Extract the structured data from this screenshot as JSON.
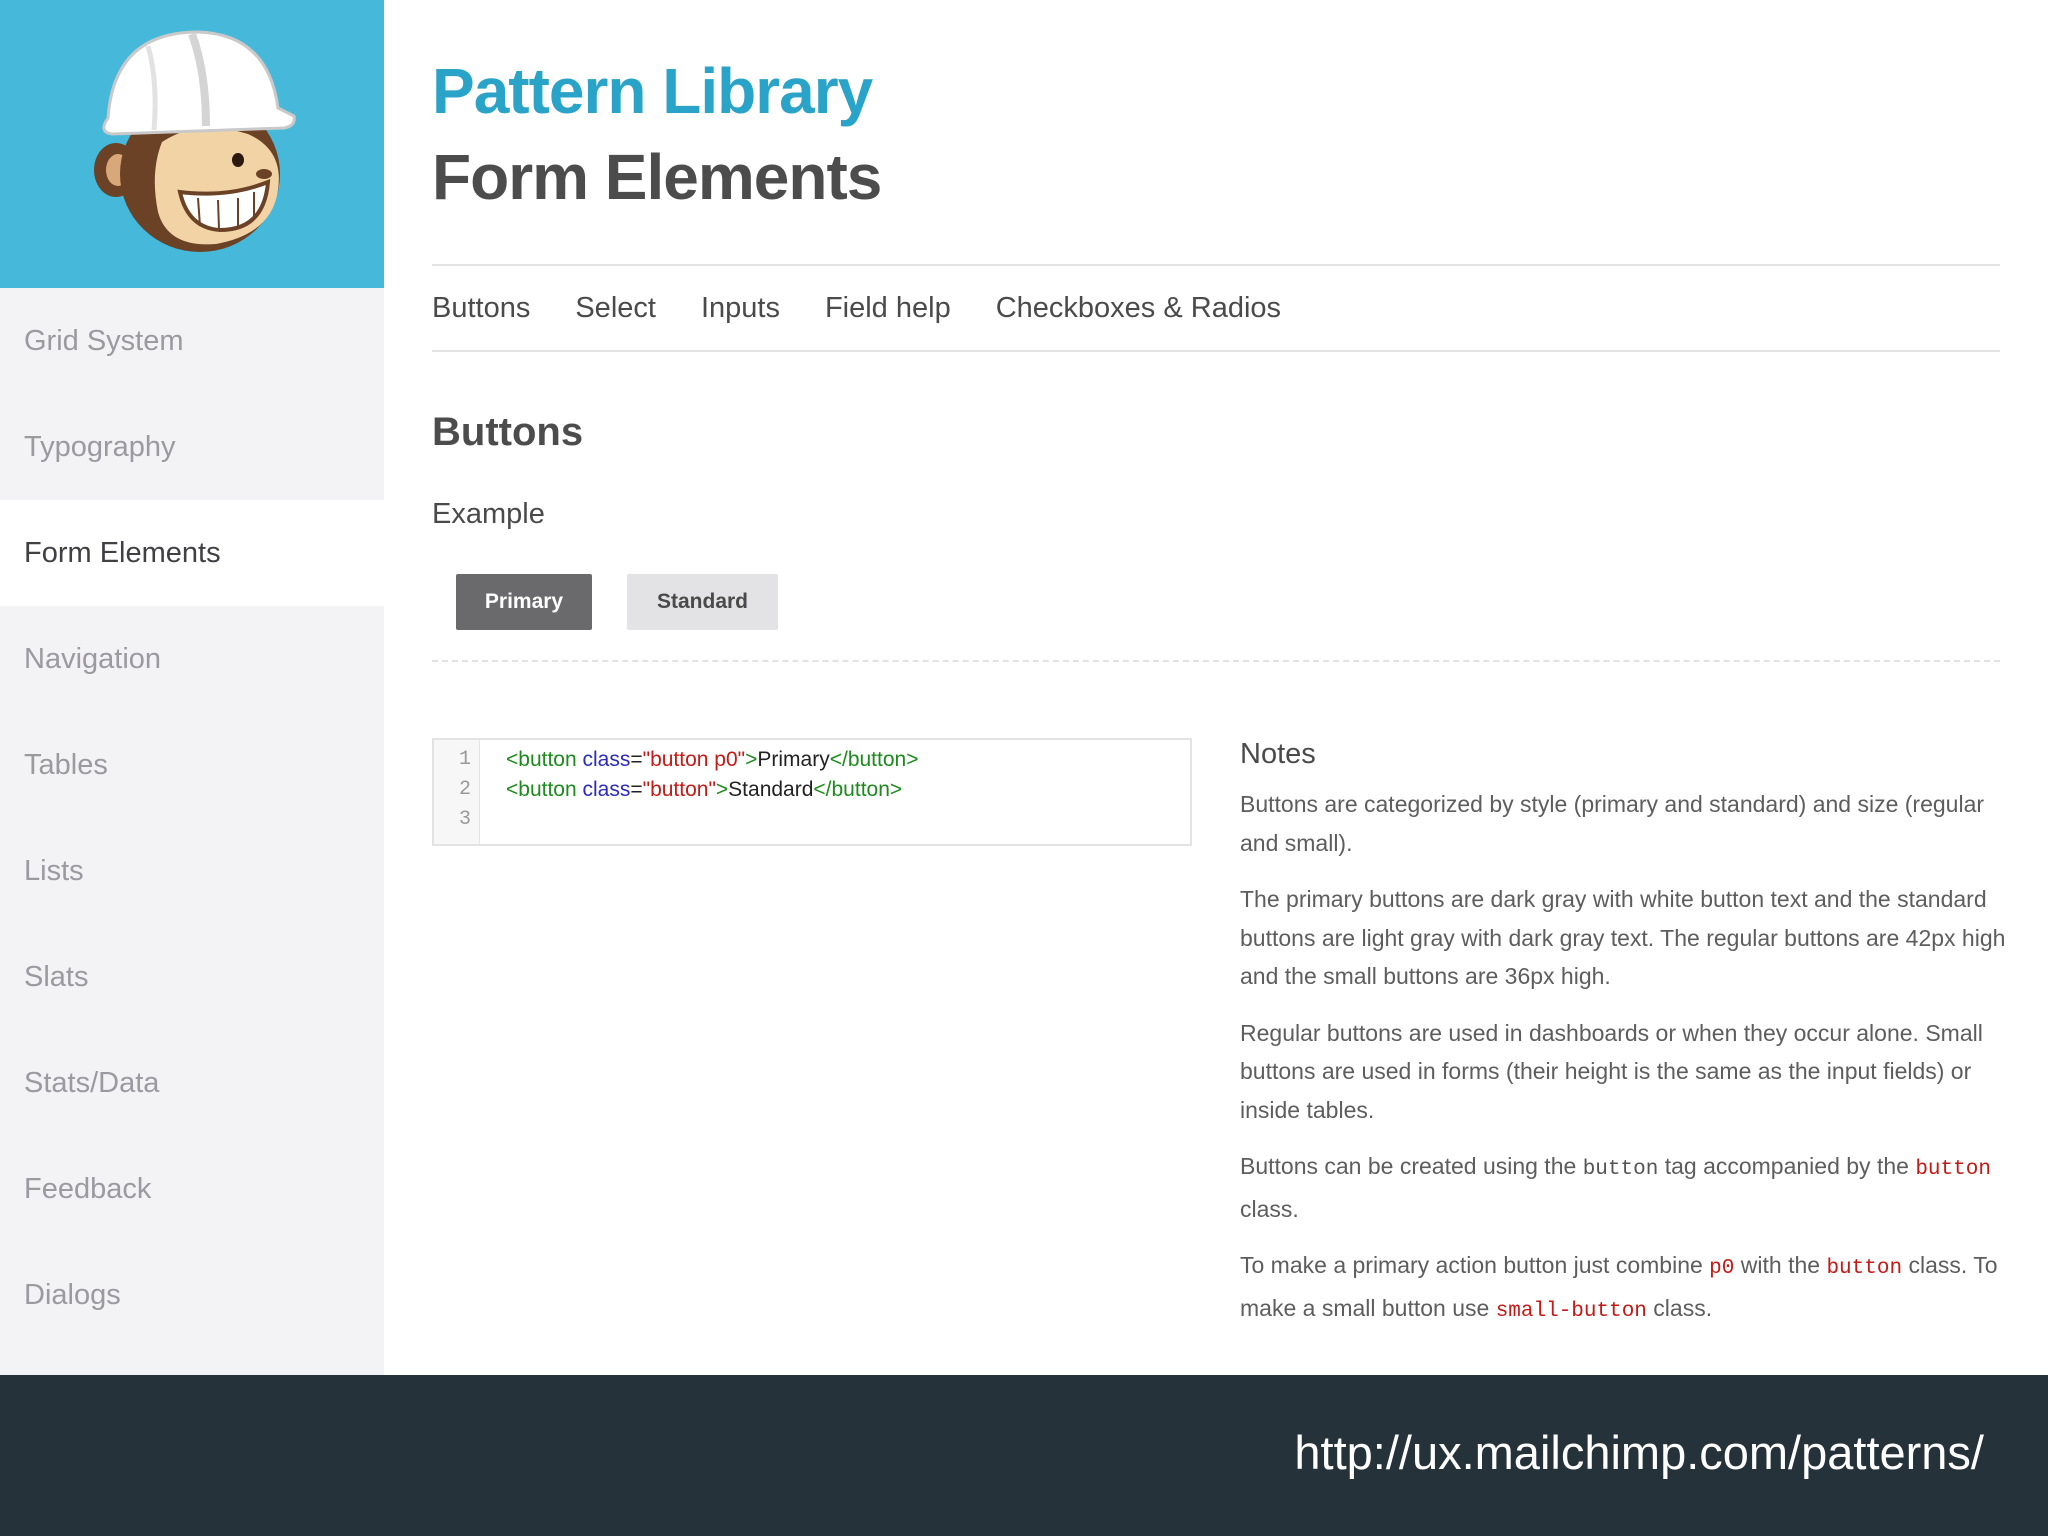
{
  "sidebar": {
    "logo": "mailchimp-freddie-hardhat-logo",
    "items": [
      {
        "label": "Grid System"
      },
      {
        "label": "Typography"
      },
      {
        "label": "Form Elements",
        "active": true
      },
      {
        "label": "Navigation"
      },
      {
        "label": "Tables"
      },
      {
        "label": "Lists"
      },
      {
        "label": "Slats"
      },
      {
        "label": "Stats/Data"
      },
      {
        "label": "Feedback"
      },
      {
        "label": "Dialogs"
      }
    ]
  },
  "header": {
    "title": "Pattern Library",
    "subtitle": "Form Elements"
  },
  "tabs": [
    "Buttons",
    "Select",
    "Inputs",
    "Field help",
    "Checkboxes & Radios"
  ],
  "section": {
    "heading": "Buttons",
    "example_label": "Example",
    "primary_button": "Primary",
    "standard_button": "Standard"
  },
  "code": {
    "line_numbers": [
      "1",
      "2",
      "3"
    ],
    "lines": [
      {
        "open": "<button",
        "attr": " class",
        "eq": "=",
        "value": "\"button p0\"",
        "close": ">",
        "text": "Primary",
        "end": "</button>"
      },
      {
        "open": "<button",
        "attr": " class",
        "eq": "=",
        "value": "\"button\"",
        "close": ">",
        "text": "Standard",
        "end": "</button>"
      }
    ]
  },
  "notes": {
    "heading": "Notes",
    "p1": "Buttons are categorized by style (primary and standard) and size (regular and small).",
    "p2": "The primary buttons are dark gray with white button text and the standard buttons are light gray with dark gray text. The regular buttons are 42px high and the small buttons are 36px high.",
    "p3": "Regular buttons are used in dashboards or when they occur alone. Small buttons are used in forms (their height is the same as the input fields) or inside tables.",
    "p4": {
      "a": "Buttons can be created using the ",
      "code1": "button",
      "b": " tag accompanied by the ",
      "code2": "button",
      "c": " class."
    },
    "p5": {
      "a": "To make a primary action button just combine ",
      "code1": "p0",
      "b": " with the ",
      "code2": "button",
      "c": " class. To make a small button use ",
      "code3": "small-button",
      "d": " class."
    }
  },
  "footer": {
    "url": "http://ux.mailchimp.com/patterns/"
  },
  "colors": {
    "accent": "#2aa3c9",
    "logo_bg": "#46b8da",
    "footer_bg": "#26323a",
    "primary_button": "#6a6a6d",
    "standard_button": "#e3e3e6"
  }
}
